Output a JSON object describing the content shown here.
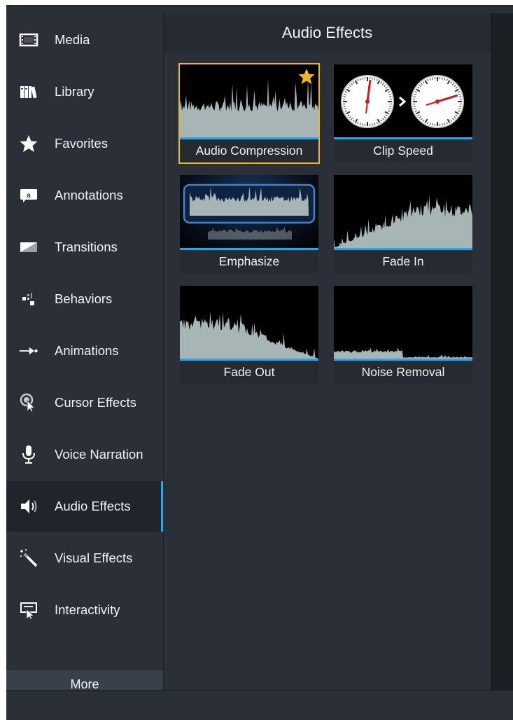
{
  "sidebar": {
    "items": [
      {
        "label": "Media",
        "icon": "film-strip-icon"
      },
      {
        "label": "Library",
        "icon": "books-icon"
      },
      {
        "label": "Favorites",
        "icon": "star-icon"
      },
      {
        "label": "Annotations",
        "icon": "speech-bubble-icon"
      },
      {
        "label": "Transitions",
        "icon": "transition-icon"
      },
      {
        "label": "Behaviors",
        "icon": "behaviors-icon"
      },
      {
        "label": "Animations",
        "icon": "arrow-right-icon"
      },
      {
        "label": "Cursor Effects",
        "icon": "cursor-icon"
      },
      {
        "label": "Voice Narration",
        "icon": "microphone-icon"
      },
      {
        "label": "Audio Effects",
        "icon": "speaker-icon"
      },
      {
        "label": "Visual Effects",
        "icon": "magic-wand-icon"
      },
      {
        "label": "Interactivity",
        "icon": "interactive-icon"
      }
    ],
    "active_index": 9,
    "more_label": "More"
  },
  "panel": {
    "title": "Audio Effects",
    "tiles": [
      {
        "label": "Audio Compression",
        "selected": true,
        "favorite": true
      },
      {
        "label": "Clip Speed",
        "selected": false,
        "favorite": false
      },
      {
        "label": "Emphasize",
        "selected": false,
        "favorite": false
      },
      {
        "label": "Fade In",
        "selected": false,
        "favorite": false
      },
      {
        "label": "Fade Out",
        "selected": false,
        "favorite": false
      },
      {
        "label": "Noise Removal",
        "selected": false,
        "favorite": false
      }
    ]
  },
  "colors": {
    "accent": "#3da4dc",
    "selection": "#e9b632",
    "waveform": "#a8b5b7",
    "background": "#2b3038"
  }
}
